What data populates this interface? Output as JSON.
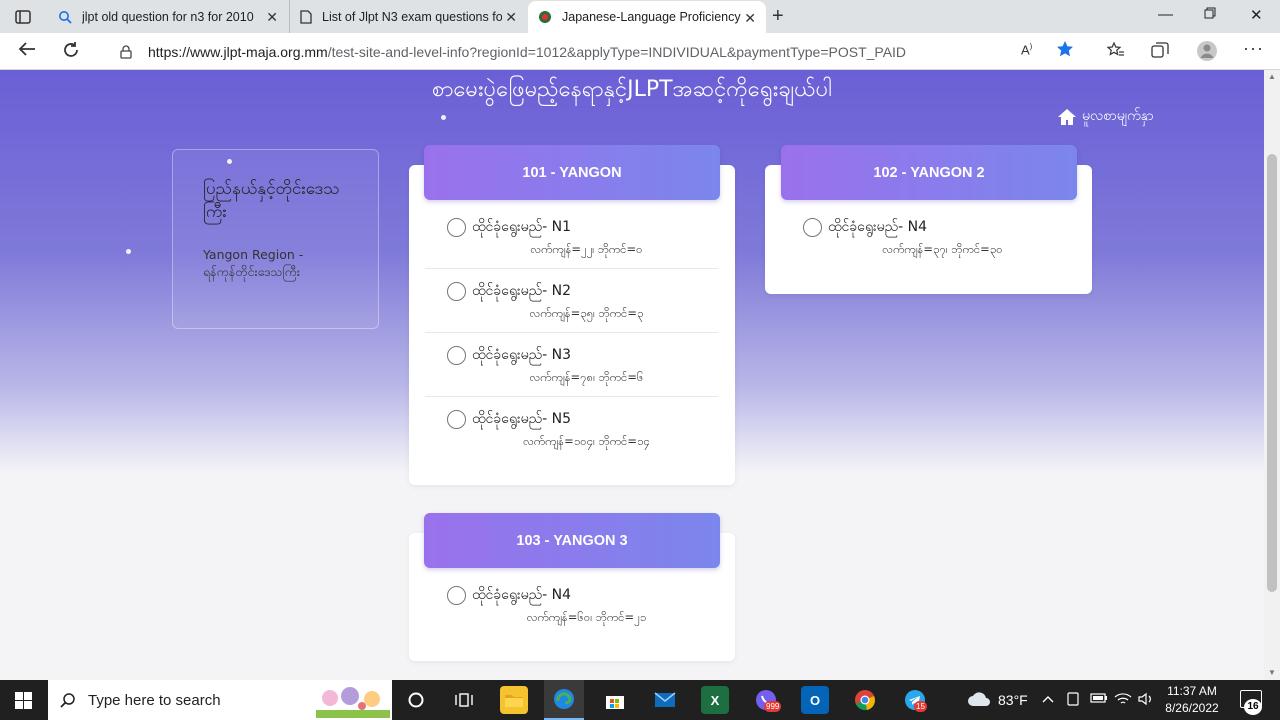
{
  "browser": {
    "tabs": [
      {
        "title": "jlpt old question for n3 for 2010"
      },
      {
        "title": "List of Jlpt N3 exam questions fo"
      },
      {
        "title": "Japanese-Language Proficiency T"
      }
    ],
    "url_host": "https://www.jlpt-maja.org.mm",
    "url_path": "/test-site-and-level-info?regionId=1012&applyType=INDIVIDUAL&paymentType=POST_PAID"
  },
  "page": {
    "title": "စာမေးပွဲဖြေမည့်နေရာနှင့်JLPTအဆင့်ကိုရွေးချယ်ပါ",
    "home_label": "မူလစာမျက်နှာ",
    "region": {
      "heading": "ပြည်နယ်နှင့်တိုင်းဒေသကြီး",
      "name": "Yangon Region - ရန်ကုန်တိုင်းဒေသကြီး"
    },
    "centers": [
      {
        "name": "101 - YANGON",
        "levels": [
          {
            "label": "ထိုင်ခုံရွေးမည်- N1",
            "meta": "လက်ကျန်=၂၂၊ ဘိုကင်=၀"
          },
          {
            "label": "ထိုင်ခုံရွေးမည်- N2",
            "meta": "လက်ကျန်=၃၅၊ ဘိုကင်=၃"
          },
          {
            "label": "ထိုင်ခုံရွေးမည်- N3",
            "meta": "လက်ကျန်=၇၈၊ ဘိုကင်=၆"
          },
          {
            "label": "ထိုင်ခုံရွေးမည်- N5",
            "meta": "လက်ကျန်=၁၀၄၊ ဘိုကင်=၁၄"
          }
        ]
      },
      {
        "name": "102 - YANGON 2",
        "levels": [
          {
            "label": "ထိုင်ခုံရွေးမည်- N4",
            "meta": "လက်ကျန်=၃၇၊ ဘိုကင်=၃၀"
          }
        ]
      },
      {
        "name": "103 - YANGON 3",
        "levels": [
          {
            "label": "ထိုင်ခုံရွေးမည်- N4",
            "meta": "လက်ကျန်=၆၀၊ ဘိုကင်=၂၁"
          }
        ]
      }
    ]
  },
  "taskbar": {
    "search_placeholder": "Type here to search",
    "weather": "83°F",
    "time": "11:37 AM",
    "date": "8/26/2022",
    "notification_count": "16",
    "viber_badge": "999",
    "telegram_badge": "15"
  }
}
